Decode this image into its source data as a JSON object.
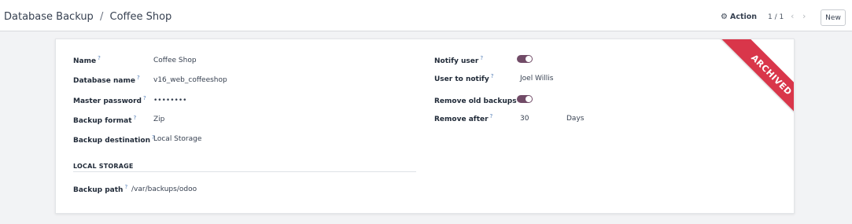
{
  "breadcrumb": {
    "parent": "Database Backup",
    "separator": "/",
    "current": "Coffee Shop"
  },
  "control_panel": {
    "action_label": "Action",
    "pager_value": "1 / 1",
    "prev_icon": "chevron-left-icon",
    "next_icon": "chevron-right-icon",
    "new_label": "New"
  },
  "ribbon": {
    "text": "ARCHIVED",
    "color": "#d9364a"
  },
  "help_mark": "?",
  "form": {
    "left": [
      {
        "label": "Name",
        "value": "Coffee Shop"
      },
      {
        "label": "Database name",
        "value": "v16_web_coffeeshop"
      },
      {
        "label": "Master password",
        "value": "••••••••"
      },
      {
        "label": "Backup format",
        "value": "Zip"
      },
      {
        "label": "Backup destination",
        "value": "Local Storage"
      }
    ],
    "local_storage": {
      "title": "LOCAL STORAGE",
      "path_label": "Backup path",
      "path_value": "/var/backups/odoo"
    },
    "right": {
      "notify_user": {
        "label": "Notify user",
        "checked": true
      },
      "user_to_notify": {
        "label": "User to notify",
        "value": "Joel Willis"
      },
      "remove_old_backups": {
        "label": "Remove old backups",
        "checked": true
      },
      "remove_after": {
        "label": "Remove after",
        "value": "30",
        "unit": "Days"
      }
    }
  },
  "colors": {
    "toggle_on": "#714b67",
    "help_mark": "#4f7bb5"
  }
}
